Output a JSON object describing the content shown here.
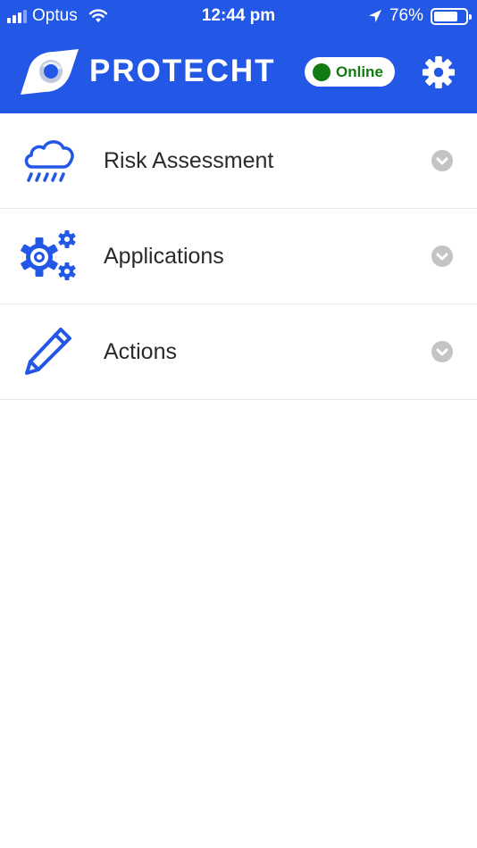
{
  "status_bar": {
    "carrier": "Optus",
    "time": "12:44 pm",
    "battery": "76%",
    "battery_level": 0.76
  },
  "header": {
    "brand": "PROTECHT",
    "status": "Online",
    "status_color": "#117a11",
    "background": "#2357e6"
  },
  "menu": {
    "items": [
      {
        "label": "Risk Assessment",
        "icon": "cloud-rain-icon"
      },
      {
        "label": "Applications",
        "icon": "gears-icon"
      },
      {
        "label": "Actions",
        "icon": "pencil-icon"
      }
    ]
  }
}
